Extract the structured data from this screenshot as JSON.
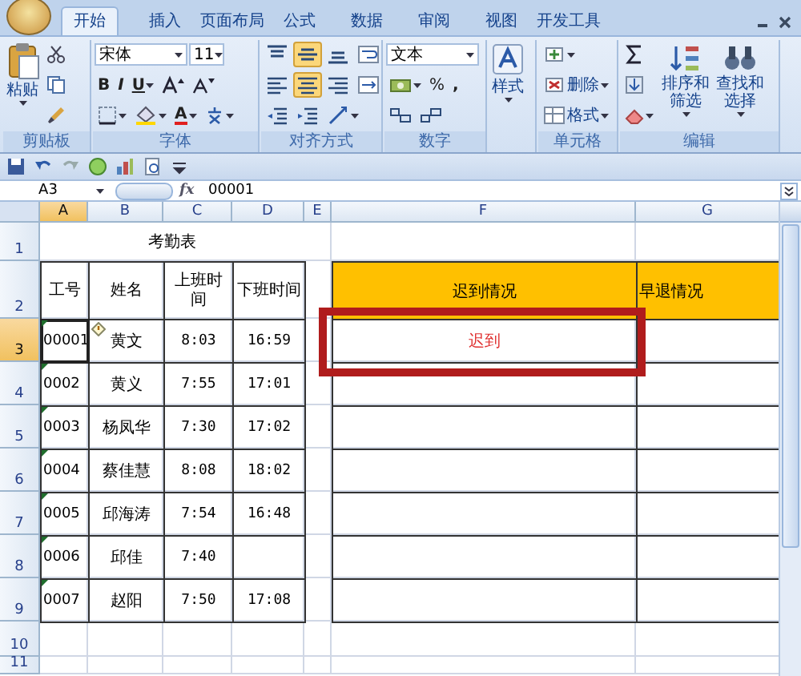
{
  "ribbon": {
    "tabs": [
      {
        "label": "开始",
        "selected": true
      },
      {
        "label": "插入",
        "selected": false
      },
      {
        "label": "页面布局",
        "selected": false
      },
      {
        "label": "公式",
        "selected": false
      },
      {
        "label": "数据",
        "selected": false
      },
      {
        "label": "审阅",
        "selected": false
      },
      {
        "label": "视图",
        "selected": false
      },
      {
        "label": "开发工具",
        "selected": false
      }
    ],
    "groups": [
      {
        "label": "剪贴板",
        "items": [
          {
            "kind": "paste",
            "text": "粘贴"
          },
          {
            "kind": "stack",
            "lines": [
              {
                "tools": [
                  {
                    "kind": "cut"
                  }
                ]
              },
              {
                "tools": [
                  {
                    "kind": "copy"
                  }
                ]
              },
              {
                "tools": [
                  {
                    "kind": "brush"
                  }
                ]
              }
            ]
          }
        ]
      },
      {
        "label": "字体",
        "items": [
          {
            "kind": "stack",
            "lines": [
              {
                "tools": [
                  {
                    "kind": "fontname",
                    "text": "宋体"
                  },
                  {
                    "kind": "fontsize",
                    "text": "11"
                  }
                ]
              },
              {
                "tools": [
                  {
                    "kind": "bold",
                    "text": "B"
                  },
                  {
                    "kind": "italic",
                    "text": "I"
                  },
                  {
                    "kind": "underline",
                    "text": "U"
                  },
                  {
                    "kind": "grow"
                  },
                  {
                    "kind": "shrink"
                  }
                ]
              },
              {
                "tools": [
                  {
                    "kind": "border"
                  },
                  {
                    "kind": "fill"
                  },
                  {
                    "kind": "fontcolor",
                    "text": "A"
                  },
                  {
                    "kind": "phonetic"
                  }
                ]
              }
            ]
          }
        ]
      },
      {
        "label": "对齐方式",
        "items": [
          {
            "kind": "stack",
            "lines": [
              {
                "tools": [
                  {
                    "kind": "top",
                    "on": false
                  },
                  {
                    "kind": "middle",
                    "on": true
                  },
                  {
                    "kind": "bottom",
                    "on": false
                  },
                  {
                    "kind": "wrap"
                  }
                ]
              },
              {
                "tools": [
                  {
                    "kind": "left",
                    "on": false
                  },
                  {
                    "kind": "center",
                    "on": true
                  },
                  {
                    "kind": "right",
                    "on": false
                  },
                  {
                    "kind": "merge"
                  }
                ]
              },
              {
                "tools": [
                  {
                    "kind": "outdent"
                  },
                  {
                    "kind": "indent"
                  },
                  {
                    "kind": "orient"
                  }
                ]
              }
            ]
          }
        ]
      },
      {
        "label": "数字",
        "items": [
          {
            "kind": "stack",
            "lines": [
              {
                "tools": [
                  {
                    "kind": "numformat",
                    "text": "文本"
                  }
                ]
              },
              {
                "tools": [
                  {
                    "kind": "currency"
                  },
                  {
                    "kind": "percent",
                    "text": "%"
                  },
                  {
                    "kind": "comma",
                    "text": ","
                  }
                ]
              },
              {
                "tools": [
                  {
                    "kind": "incdec"
                  },
                  {
                    "kind": "decdec"
                  }
                ]
              }
            ]
          }
        ]
      },
      {
        "items": [
          {
            "kind": "styles",
            "text": "样式"
          }
        ]
      },
      {
        "label": "单元格",
        "items": [
          {
            "kind": "stack",
            "lines": [
              {
                "tools": [
                  {
                    "kind": "insert"
                  }
                ]
              },
              {
                "tools": [
                  {
                    "kind": "delete",
                    "text": "删除"
                  }
                ]
              },
              {
                "tools": [
                  {
                    "kind": "format",
                    "text": "格式"
                  }
                ]
              }
            ]
          }
        ]
      },
      {
        "label": "编辑",
        "items": [
          {
            "kind": "stack",
            "lines": [
              {
                "tools": [
                  {
                    "kind": "sum"
                  }
                ]
              },
              {
                "tools": [
                  {
                    "kind": "filldown"
                  }
                ]
              },
              {
                "tools": [
                  {
                    "kind": "clear"
                  }
                ]
              }
            ]
          },
          {
            "kind": "sort",
            "text": "排序和筛选"
          },
          {
            "kind": "find",
            "text": "查找和选择"
          }
        ]
      }
    ]
  },
  "formula_bar": {
    "name_box": "A3",
    "function_label": "fx",
    "formula": "00001"
  },
  "sheet": {
    "columns": [
      {
        "label": "A",
        "selected": true
      },
      {
        "label": "B",
        "selected": false
      },
      {
        "label": "C",
        "selected": false
      },
      {
        "label": "D",
        "selected": false
      },
      {
        "label": "E",
        "selected": false
      },
      {
        "label": "F",
        "selected": false
      },
      {
        "label": "G",
        "selected": false
      }
    ],
    "rows": [
      {
        "label": "1",
        "selected": false
      },
      {
        "label": "2",
        "selected": false
      },
      {
        "label": "3",
        "selected": true
      },
      {
        "label": "4",
        "selected": false
      },
      {
        "label": "5",
        "selected": false
      },
      {
        "label": "6",
        "selected": false
      },
      {
        "label": "7",
        "selected": false
      },
      {
        "label": "8",
        "selected": false
      },
      {
        "label": "9",
        "selected": false
      },
      {
        "label": "10",
        "selected": false
      },
      {
        "label": "11",
        "selected": false
      }
    ],
    "title": "考勤表",
    "headers": [
      "工号",
      "姓名",
      "上班时间",
      "下班时间"
    ],
    "status_headers": [
      "迟到情况",
      "早退情况"
    ],
    "records": [
      {
        "id": "00001",
        "name": "黄文",
        "clock_in": "8:03",
        "clock_out": "16:59",
        "late": "迟到",
        "selected": true,
        "flagged": true,
        "highlighted": true
      },
      {
        "id": "0002",
        "name": "黄义",
        "clock_in": "7:55",
        "clock_out": "17:01",
        "selected": false,
        "flagged": true,
        "highlighted": false
      },
      {
        "id": "0003",
        "name": "杨凤华",
        "clock_in": "7:30",
        "clock_out": "17:02",
        "selected": false,
        "flagged": true,
        "highlighted": false
      },
      {
        "id": "0004",
        "name": "蔡佳慧",
        "clock_in": "8:08",
        "clock_out": "18:02",
        "selected": false,
        "flagged": true,
        "highlighted": false
      },
      {
        "id": "0005",
        "name": "邱海涛",
        "clock_in": "7:54",
        "clock_out": "16:48",
        "selected": false,
        "flagged": true,
        "highlighted": false
      },
      {
        "id": "0006",
        "name": "邱佳",
        "clock_in": "7:40",
        "selected": false,
        "flagged": true,
        "highlighted": false
      },
      {
        "id": "0007",
        "name": "赵阳",
        "clock_in": "7:50",
        "clock_out": "17:08",
        "selected": false,
        "flagged": true,
        "highlighted": false
      }
    ]
  }
}
